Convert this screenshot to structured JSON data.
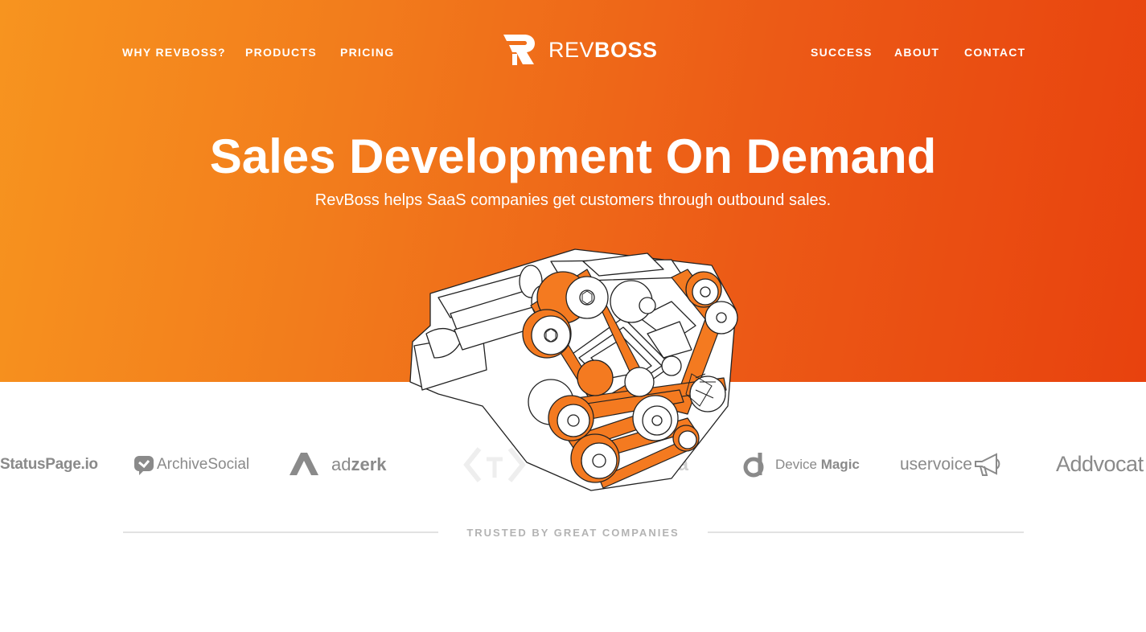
{
  "nav": {
    "left": [
      "WHY REVBOSS?",
      "PRODUCTS",
      "PRICING"
    ],
    "right": [
      "SUCCESS",
      "ABOUT",
      "CONTACT"
    ]
  },
  "logo": {
    "text_light": "REV",
    "text_bold": "BOSS",
    "icon": "revboss-r-logo-icon"
  },
  "hero": {
    "headline": "Sales Development On Demand",
    "subheadline": "RevBoss helps SaaS companies get customers through outbound sales.",
    "illustration": "engine-illustration"
  },
  "customers": {
    "statuspage": "StatusPage.io",
    "archivesocial": "ArchiveSocial",
    "adzerk_light": "ad",
    "adzerk_bold": "zerk",
    "assembla_fragment": "mbla",
    "devicemagic_light": "Device ",
    "devicemagic_bold": "Magic",
    "uservoice": "uservoice",
    "addvocate": "Addvocat"
  },
  "trusted_label": "TRUSTED BY GREAT COMPANIES",
  "colors": {
    "gradient_start": "#f7941f",
    "gradient_end": "#e8420e",
    "accent_orange": "#f47a20",
    "logo_gray": "#8a8a8a"
  }
}
